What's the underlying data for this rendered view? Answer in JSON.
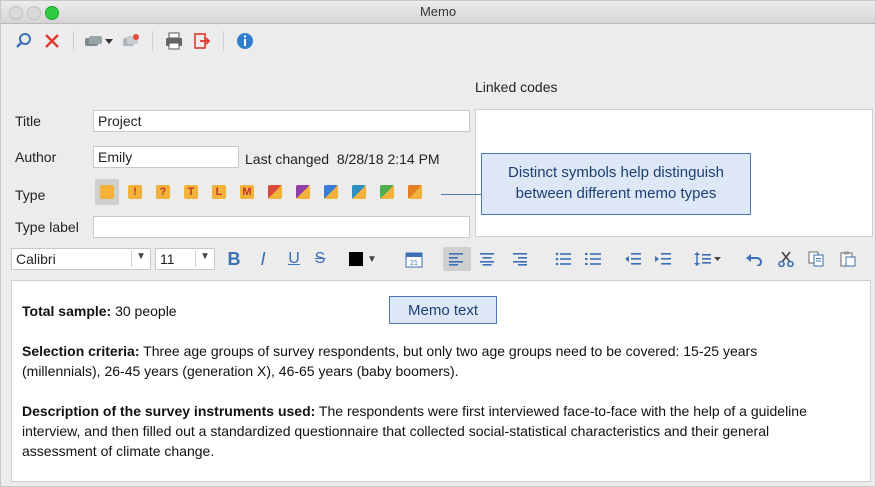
{
  "window": {
    "title": "Memo"
  },
  "toolbar": {
    "icons": [
      "search-icon",
      "delete-icon",
      "link-icon",
      "unlink-icon",
      "print-icon",
      "export-icon",
      "info-icon"
    ]
  },
  "linked_codes": {
    "label": "Linked codes"
  },
  "form": {
    "title_label": "Title",
    "title_value": "Project",
    "author_label": "Author",
    "author_value": "Emily",
    "last_changed_label": "Last changed",
    "last_changed_value": "8/28/18 2:14 PM",
    "type_label": "Type",
    "type_label_label": "Type label",
    "type_label_value": ""
  },
  "memo_types": [
    {
      "symbol": "",
      "color": "#f3b23b",
      "selected": true
    },
    {
      "symbol": "!",
      "color": "#f3b23b"
    },
    {
      "symbol": "?",
      "color": "#f3b23b"
    },
    {
      "symbol": "T",
      "color": "#f3b23b"
    },
    {
      "symbol": "L",
      "color": "#f3b23b"
    },
    {
      "symbol": "M",
      "color": "#f3b23b"
    },
    {
      "symbol": "",
      "color": "#d94a3a"
    },
    {
      "symbol": "",
      "color": "#8e3fa8"
    },
    {
      "symbol": "",
      "color": "#3a7bd5"
    },
    {
      "symbol": "",
      "color": "#2f8fbf"
    },
    {
      "symbol": "",
      "color": "#4caf50"
    },
    {
      "symbol": "",
      "color": "#e67e22"
    }
  ],
  "callouts": {
    "types": "Distinct symbols help distinguish between different memo types",
    "memo": "Memo text"
  },
  "format": {
    "font": "Calibri",
    "size": "11",
    "bold": "B",
    "italic": "I",
    "underline": "U",
    "strike": "S",
    "text_color": "#000000"
  },
  "memo": {
    "p1_bold": "Total sample:",
    "p1_text": " 30 people",
    "p2_bold": "Selection criteria:",
    "p2_text": " Three age groups of survey respondents, but only two age groups need to be covered: 15-25 years (millennials), 26-45 years (generation X), 46-65 years (baby boomers).",
    "p3_bold": "Description of the survey instruments used:",
    "p3_text": " The respondents were first interviewed face-to-face with the help of a guideline interview, and then filled out a standardized questionnaire that collected social-statistical characteristics and their general assessment of climate change."
  }
}
